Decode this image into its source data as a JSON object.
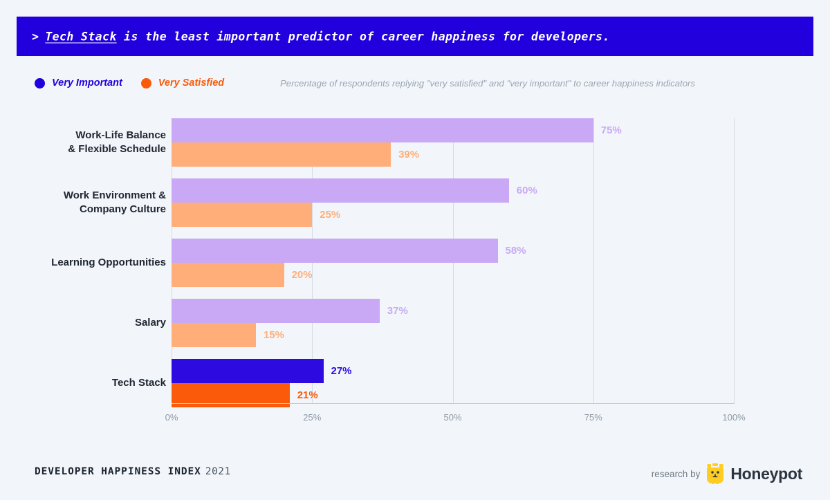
{
  "header": {
    "chevron": ">",
    "highlight": "Tech Stack",
    "rest": " is the least important predictor of career happiness for developers."
  },
  "legend": {
    "entries": [
      {
        "label": "Very Important",
        "color": "#2200dd",
        "icon": "circle-icon"
      },
      {
        "label": "Very Satisfied",
        "color": "#fa5a0a",
        "icon": "circle-icon"
      }
    ]
  },
  "subtitle": "Percentage of respondents replying \"very satisfied\" and \"very important\" to career happiness indicators",
  "footer": {
    "index_label": "DEVELOPER HAPPINESS INDEX",
    "year": "2021",
    "research_by": "research by",
    "brand": "Honeypot",
    "brand_icon": "honeypot-bear-icon"
  },
  "chart_data": {
    "type": "bar",
    "orientation": "horizontal",
    "title": "",
    "xlabel": "",
    "ylabel": "",
    "xlim": [
      0,
      100
    ],
    "xticks": [
      "0%",
      "25%",
      "50%",
      "75%",
      "100%"
    ],
    "xtick_values": [
      0,
      25,
      50,
      75,
      100
    ],
    "grid": true,
    "grid_axis": "x",
    "legend_position": "top-left",
    "categories": [
      "Work-Life Balance\n& Flexible Schedule",
      "Work Environment &\nCompany Culture",
      "Learning Opportunities",
      "Salary",
      "Tech Stack"
    ],
    "series": [
      {
        "name": "Very Important",
        "values": [
          75,
          60,
          58,
          37,
          27
        ],
        "labels": [
          "75%",
          "60%",
          "58%",
          "37%",
          "27%"
        ],
        "color": "#c9a9f5",
        "highlight_color": "#2d0ae0",
        "highlight_index": 4
      },
      {
        "name": "Very Satisfied",
        "values": [
          39,
          25,
          20,
          15,
          21
        ],
        "labels": [
          "39%",
          "25%",
          "20%",
          "15%",
          "21%"
        ],
        "color": "#ffae79",
        "highlight_color": "#fa5a0a",
        "highlight_index": 4
      }
    ]
  }
}
